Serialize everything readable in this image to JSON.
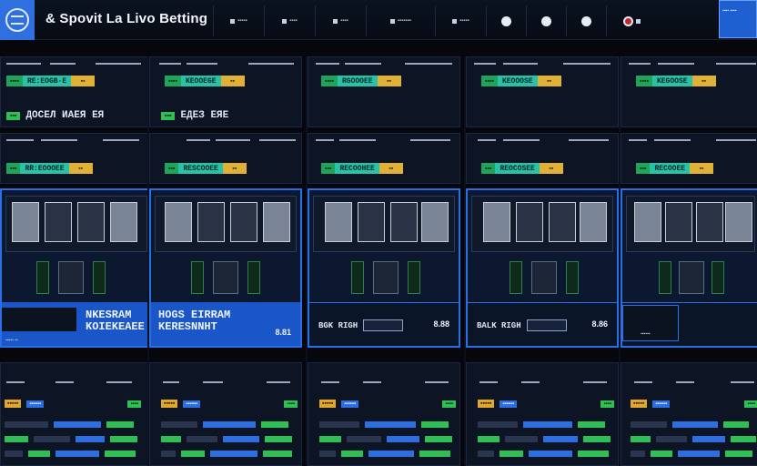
{
  "app": {
    "title": "& Spovit La Livo Betting",
    "nav": [
      "▪▪▪▪▪",
      "▪▪▪▪",
      "▪▪▪▪",
      "▪▪▪▪▪▪▪",
      "▪▪▪▪▪"
    ],
    "account": "▪▪▪▪ ▪▪▪▪"
  },
  "columns": [
    {
      "top_card": {
        "odds_green": "▪▪▪▪",
        "odds_teal": "RE:EOGB·E",
        "odds_amber": "▪▪"
      },
      "match": {
        "pill": "▪▪▪",
        "name": "ДОСЕЛ ИАЕЯ ЕЯ"
      },
      "mid_card": {
        "odds_green": "▪▪▪",
        "odds_teal": "RR:EOOOEE",
        "odds_amber": "▪▪"
      },
      "panel": {
        "title_line1": "",
        "title_line2": "",
        "footer_label": "NKESRAM",
        "footer_label2": "KOIEKEAEE",
        "footer_odds": "",
        "tag": "▪▪▪▪▪ ▪▪"
      },
      "bottom": {
        "amber": "▪▪▪▪▪",
        "blue": "▪▪▪▪▪▪",
        "green": "▪▪▪▪"
      }
    },
    {
      "top_card": {
        "odds_green": "▪▪▪▪",
        "odds_teal": "KEOOEGE",
        "odds_amber": "▪▪"
      },
      "match": {
        "pill": "▪▪▪",
        "name": "ЕДЕЗ ЕЯЕ"
      },
      "mid_card": {
        "odds_green": "▪▪▪",
        "odds_teal": "RESCOOEE",
        "odds_amber": "▪▪"
      },
      "panel": {
        "title_line1": "HOGS EIRRAM",
        "title_line2": "KERESNNHT",
        "footer_label": "",
        "footer_label2": "",
        "footer_odds": "8.81",
        "tag": ""
      },
      "bottom": {
        "amber": "▪▪▪▪▪",
        "blue": "▪▪▪▪▪▪",
        "green": "▪▪▪▪"
      }
    },
    {
      "top_card": {
        "odds_green": "▪▪▪▪",
        "odds_teal": "RGOOOEE",
        "odds_amber": "▪▪"
      },
      "match": {
        "pill": "",
        "name": ""
      },
      "mid_card": {
        "odds_green": "▪▪▪",
        "odds_teal": "RECOOHEE",
        "odds_amber": "▪▪"
      },
      "panel": {
        "title_line1": "",
        "title_line2": "",
        "footer_label": "BGK RIGH",
        "footer_label2": "",
        "footer_odds": "8.88",
        "tag": ""
      },
      "bottom": {
        "amber": "▪▪▪▪▪",
        "blue": "▪▪▪▪▪▪",
        "green": "▪▪▪▪"
      }
    },
    {
      "top_card": {
        "odds_green": "▪▪▪▪",
        "odds_teal": "KEOOOSE",
        "odds_amber": "▪▪"
      },
      "match": {
        "pill": "",
        "name": ""
      },
      "mid_card": {
        "odds_green": "▪▪▪",
        "odds_teal": "REOCOSEE",
        "odds_amber": "▪▪"
      },
      "panel": {
        "title_line1": "",
        "title_line2": "",
        "footer_label": "BALK RIGH",
        "footer_label2": "",
        "footer_odds": "8.86",
        "tag": ""
      },
      "bottom": {
        "amber": "▪▪▪▪▪",
        "blue": "▪▪▪▪▪▪",
        "green": "▪▪▪▪"
      }
    },
    {
      "top_card": {
        "odds_green": "▪▪▪▪",
        "odds_teal": "KEGOOSE",
        "odds_amber": "▪▪"
      },
      "match": {
        "pill": "",
        "name": ""
      },
      "mid_card": {
        "odds_green": "▪▪▪",
        "odds_teal": "RECOOEE",
        "odds_amber": "▪▪"
      },
      "panel": {
        "title_line1": "",
        "title_line2": "",
        "footer_label": "",
        "footer_label2": "",
        "footer_odds": "",
        "tag": "▪▪▪▪▪▪"
      },
      "bottom": {
        "amber": "▪▪▪▪▪",
        "blue": "▪▪▪▪▪▪",
        "green": "▪▪▪▪"
      }
    }
  ],
  "colors": {
    "accent": "#2a6fe6",
    "odds_green": "#1ea55a",
    "odds_teal": "#27c2a8",
    "odds_amber": "#e0b134"
  }
}
